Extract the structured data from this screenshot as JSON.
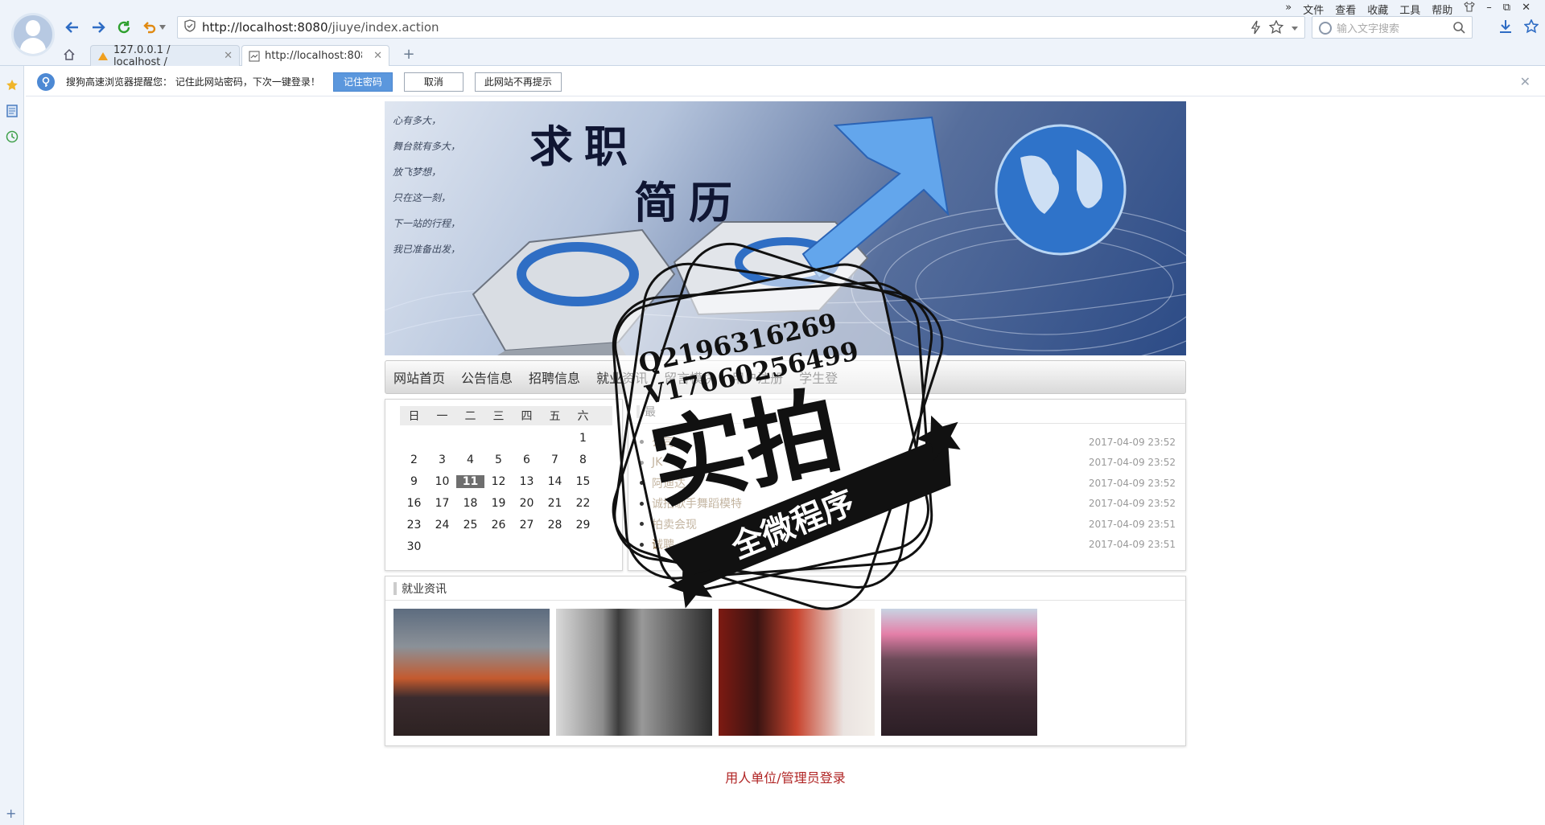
{
  "browser": {
    "url_host": "http://localhost:8080",
    "url_rest": "/jiuye/index.action",
    "search_placeholder": "输入文字搜索",
    "menu": [
      "»",
      "文件",
      "查看",
      "收藏",
      "工具",
      "帮助"
    ],
    "tabs": [
      {
        "label": "127.0.0.1 / localhost /"
      },
      {
        "label": "http://localhost:8080/ji"
      }
    ]
  },
  "infobar": {
    "message": "搜狗高速浏览器提醒您： 记住此网站密码，下次一键登录！",
    "remember_btn": "记住密码",
    "cancel_btn": "取消",
    "never_btn": "此网站不再提示"
  },
  "banner": {
    "poem": [
      "心有多大，",
      "舞台就有多大，",
      "放飞梦想，",
      "只在这一刻，",
      "下一站的行程，",
      "我已准备出发，"
    ],
    "title_line1": "求职",
    "title_line2": "简历"
  },
  "nav": [
    "网站首页",
    "公告信息",
    "招聘信息",
    "就业资讯",
    "留言模块",
    "用户注册",
    "学生登"
  ],
  "calendar": {
    "weekdays": [
      "日",
      "一",
      "二",
      "三",
      "四",
      "五",
      "六"
    ],
    "days": [
      "",
      "",
      "",
      "",
      "",
      "",
      "1",
      "2",
      "3",
      "4",
      "5",
      "6",
      "7",
      "8",
      "9",
      "10",
      "11",
      "12",
      "13",
      "14",
      "15",
      "16",
      "17",
      "18",
      "19",
      "20",
      "21",
      "22",
      "23",
      "24",
      "25",
      "26",
      "27",
      "28",
      "29",
      "30"
    ],
    "today": "11"
  },
  "news": {
    "title": "最",
    "items": [
      {
        "title": "公司",
        "date": "2017-04-09 23:52"
      },
      {
        "title": "JK",
        "date": "2017-04-09 23:52"
      },
      {
        "title": "阿迪达",
        "date": "2017-04-09 23:52"
      },
      {
        "title": "诚招歌手舞蹈模特",
        "date": "2017-04-09 23:52"
      },
      {
        "title": "拍卖会现",
        "date": "2017-04-09 23:51"
      },
      {
        "title": "诚聘",
        "date": "2017-04-09 23:51"
      }
    ]
  },
  "jobnews": {
    "title": "就业资讯"
  },
  "footer": {
    "login_link": "用人单位/管理员登录"
  },
  "watermark": {
    "line1": "Q2196316269",
    "line2": "V17060256499",
    "big": "实拍",
    "sub": "全微程序"
  }
}
